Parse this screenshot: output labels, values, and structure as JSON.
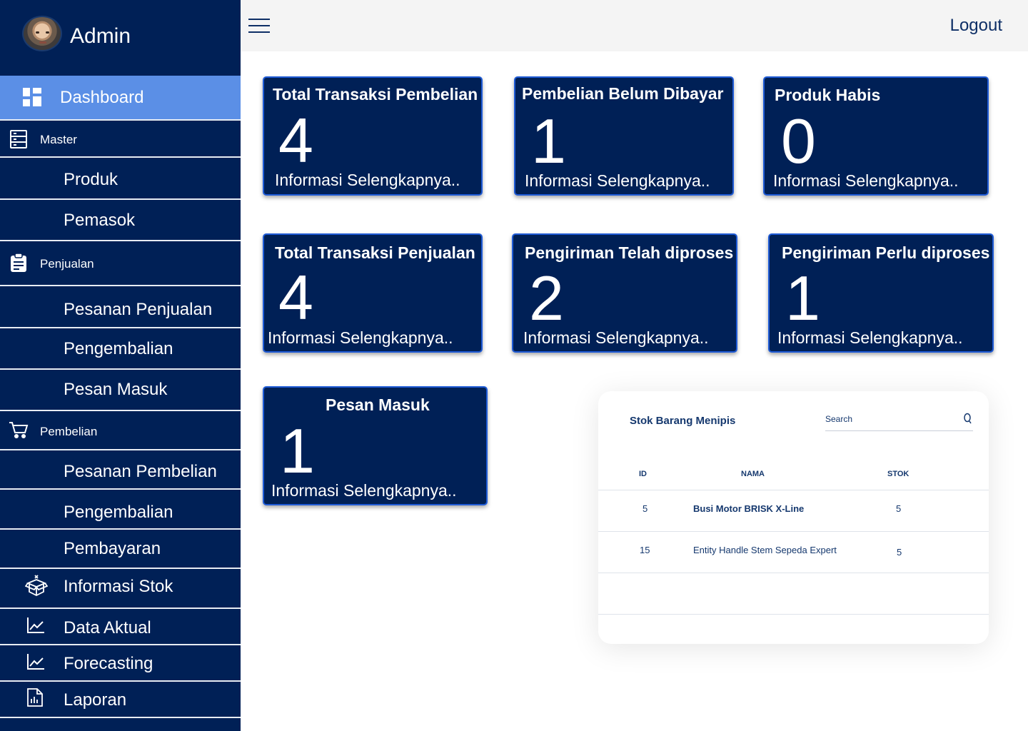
{
  "sidebar": {
    "user_name": "Admin",
    "items": [
      {
        "label": "Dashboard",
        "icon": "dashboard-icon"
      },
      {
        "label": "Master",
        "icon": "server-icon"
      },
      {
        "label": "Produk"
      },
      {
        "label": "Pemasok"
      },
      {
        "label": "Penjualan",
        "icon": "clipboard-icon"
      },
      {
        "label": "Pesanan Penjualan"
      },
      {
        "label": "Pengembalian"
      },
      {
        "label": "Pesan Masuk"
      },
      {
        "label": "Pembelian",
        "icon": "cart-icon"
      },
      {
        "label": "Pesanan Pembelian"
      },
      {
        "label": "Pengembalian"
      },
      {
        "label": "Pembayaran"
      },
      {
        "label": "Informasi Stok",
        "icon": "box-icon"
      },
      {
        "label": "Data Aktual",
        "icon": "chart-line-icon"
      },
      {
        "label": "Forecasting",
        "icon": "chart-line-icon"
      },
      {
        "label": "Laporan",
        "icon": "report-icon"
      }
    ]
  },
  "topbar": {
    "logout_label": "Logout"
  },
  "cards": [
    {
      "title": "Total Transaksi Pembelian",
      "value": "4",
      "link": "Informasi Selengkapnya.."
    },
    {
      "title": "Pembelian Belum Dibayar",
      "value": "1",
      "link": "Informasi Selengkapnya.."
    },
    {
      "title": "Produk Habis",
      "value": "0",
      "link": "Informasi Selengkapnya.."
    },
    {
      "title": "Total Transaksi Penjualan",
      "value": "4",
      "link": "Informasi Selengkapnya.."
    },
    {
      "title": "Pengiriman Telah diproses",
      "value": "2",
      "link": "Informasi Selengkapnya.."
    },
    {
      "title": "Pengiriman Perlu diproses",
      "value": "1",
      "link": "Informasi Selengkapnya.."
    },
    {
      "title": "Pesan Masuk",
      "value": "1",
      "link": "Informasi Selengkapnya.."
    }
  ],
  "stock_table": {
    "title": "Stok Barang Menipis",
    "search_placeholder": "Search",
    "columns": [
      "ID",
      "NAMA",
      "STOK"
    ],
    "rows": [
      {
        "id": "5",
        "nama": "Busi Motor BRISK X-Line",
        "stok": "5"
      },
      {
        "id": "15",
        "nama": "Entity Handle Stem Sepeda Expert",
        "stok": "5"
      }
    ]
  },
  "colors": {
    "sidebar_bg": "#002056",
    "active_item": "#5b8fe6",
    "card_bg": "#002056",
    "card_border": "#1f5bd6",
    "topbar_bg": "#f4f4f4"
  }
}
